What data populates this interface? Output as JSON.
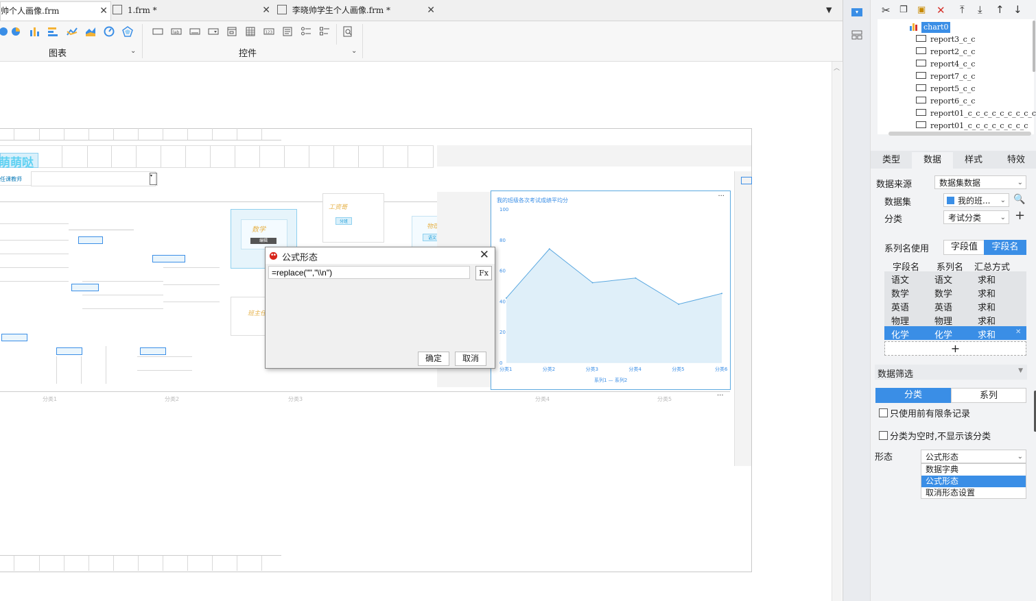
{
  "tabs": [
    {
      "label": "帅个人画像.frm",
      "active": true
    },
    {
      "label": "1.frm *",
      "active": false
    },
    {
      "label": "李晓帅学生个人画像.frm *",
      "active": false
    }
  ],
  "toolbar": {
    "groups": [
      {
        "label": "图表"
      },
      {
        "label": "控件"
      }
    ]
  },
  "canvas": {
    "big_title": "萌萌哒",
    "field_label": "任课教师",
    "popup_label_1": "数学",
    "popup_label_2": "工资哥",
    "popup_label_3": "物理",
    "popup_label_4": "分班",
    "popup_label_5": "语文",
    "popup_label_6": "班主任",
    "popup_edit": "编辑",
    "category_labels": [
      "分类1",
      "分类2",
      "分类3",
      "分类4",
      "分类5"
    ],
    "chart_more": "···",
    "page_more": "···"
  },
  "chart_data": {
    "type": "area",
    "title": "我的班级各次考试成绩平均分",
    "x": [
      "分类1",
      "分类2",
      "分类3",
      "分类4",
      "分类5",
      "分类6"
    ],
    "series": [
      {
        "name": "系列1",
        "values": [
          42,
          74,
          52,
          55,
          38,
          45
        ]
      }
    ],
    "legend": [
      "系列1",
      "系列2"
    ],
    "ylim": [
      0,
      100
    ],
    "yticks": [
      "0",
      "20",
      "40",
      "60",
      "80",
      "100"
    ],
    "accent": "#5aa8e0"
  },
  "dialog": {
    "title": "公式形态",
    "formula": "=replace(\"\",\"\\\\n\")",
    "fx_label": "Fx",
    "ok": "确定",
    "cancel": "取消",
    "close_icon": "close-icon"
  },
  "tree": {
    "selected": "chart0",
    "items": [
      "chart0",
      "report3_c_c",
      "report2_c_c",
      "report4_c_c",
      "report7_c_c",
      "report5_c_c",
      "report6_c_c",
      "report01_c_c_c_c_c_c_c_c_c",
      "report01_c_c_c_c_c_c_c_c"
    ]
  },
  "panel": {
    "tabs": [
      "类型",
      "数据",
      "样式",
      "特效"
    ],
    "active_tab": "数据",
    "data_source_label": "数据来源",
    "data_source_value": "数据集数据",
    "dataset_label": "数据集",
    "dataset_value": "我的班...",
    "category_label": "分类",
    "category_value": "考试分类",
    "series_use_label": "系列名使用",
    "series_use_options": [
      "字段值",
      "字段名"
    ],
    "series_use_active": "字段名",
    "table_headers": [
      "字段名",
      "系列名",
      "汇总方式"
    ],
    "rows": [
      {
        "field": "语文",
        "series": "语文",
        "agg": "求和"
      },
      {
        "field": "数学",
        "series": "数学",
        "agg": "求和"
      },
      {
        "field": "英语",
        "series": "英语",
        "agg": "求和"
      },
      {
        "field": "物理",
        "series": "物理",
        "agg": "求和"
      },
      {
        "field": "化学",
        "series": "化学",
        "agg": "求和"
      }
    ],
    "selected_row": 4,
    "add_label": "+",
    "filter_label": "数据筛选",
    "filter_tabs": [
      "分类",
      "系列"
    ],
    "filter_active": "分类",
    "check_top_n": "只使用前有限条记录",
    "check_empty": "分类为空时,不显示该分类",
    "form_label": "形态",
    "form_value": "公式形态",
    "form_options": [
      "数据字典",
      "公式形态",
      "取消形态设置"
    ],
    "form_selected": "公式形态"
  }
}
